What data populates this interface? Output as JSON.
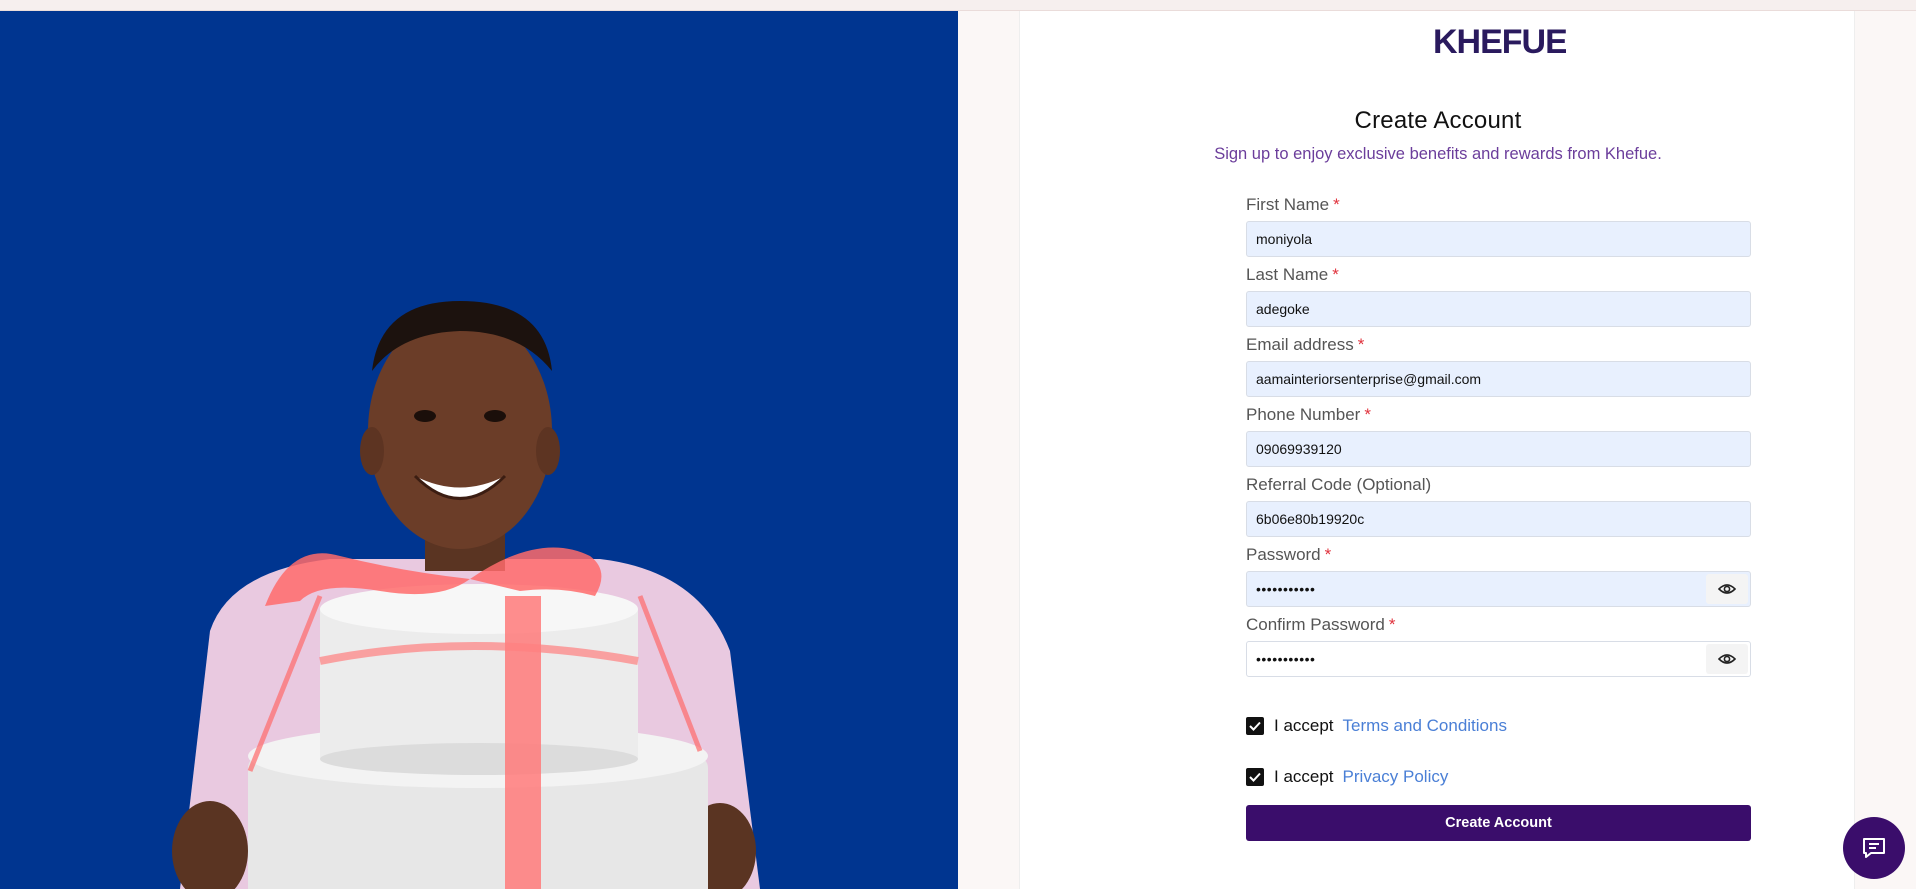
{
  "brand": {
    "logo_text": "KHEFUE",
    "logo_color": "#2a1a5e"
  },
  "hero": {
    "image_alt": "smiling man holding gift boxes",
    "background": "#003590"
  },
  "form": {
    "title": "Create Account",
    "subtitle": "Sign up to enjoy exclusive benefits and rewards from Khefue.",
    "required_marker": "*",
    "fields": {
      "first_name": {
        "label": "First Name",
        "value": "moniyola"
      },
      "last_name": {
        "label": "Last Name",
        "value": "adegoke"
      },
      "email": {
        "label": "Email address",
        "value": "aamainteriorsenterprise@gmail.com"
      },
      "phone": {
        "label": "Phone Number",
        "value": "09069939120"
      },
      "referral": {
        "label": "Referral Code (Optional)",
        "value": "6b06e80b19920c"
      },
      "password": {
        "label": "Password",
        "value": "•••••••••••"
      },
      "confirm_password": {
        "label": "Confirm Password",
        "value": "•••••••••••"
      }
    },
    "terms": {
      "prefix": "I accept",
      "link": "Terms and Conditions",
      "checked": true
    },
    "privacy": {
      "prefix": "I accept",
      "link": "Privacy Policy",
      "checked": true
    },
    "submit_label": "Create Account"
  },
  "colors": {
    "accent": "#3a0d6b",
    "link": "#4a7fd6",
    "required": "#e0323c",
    "subtitle": "#6b3d9b"
  },
  "icons": {
    "password_toggle": "eye-icon",
    "chat": "chat-icon"
  }
}
